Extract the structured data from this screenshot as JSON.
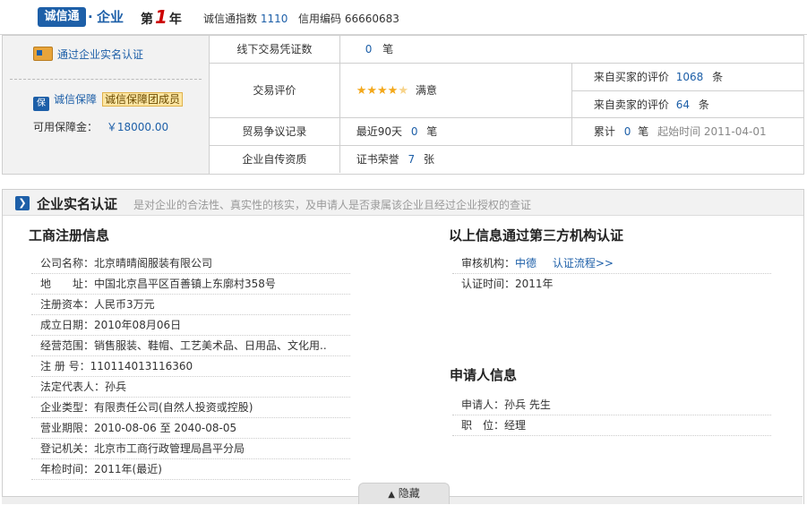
{
  "header": {
    "logo_text": "诚信通",
    "logo_dot": "·",
    "logo_ent": "企业",
    "year_prefix": "第",
    "year_num": "1",
    "year_suffix": "年",
    "index_label": "诚信通指数",
    "index_value": "1110",
    "code_label": "信用编码",
    "code_value": "66660683"
  },
  "left_panel": {
    "verify_link": "通过企业实名认证",
    "guarantee_icon": "保",
    "guarantee_label": "诚信保障",
    "guarantee_badge": "诚信保障团成员",
    "deposit_label": "可用保障金：",
    "deposit_value": "￥18000.00"
  },
  "grid": {
    "offline_label": "线下交易凭证数",
    "offline_value": "0",
    "offline_unit": "笔",
    "eval_label": "交易评价",
    "eval_rating": "满意",
    "eval_stars": 4.5,
    "buyer_label": "来自买家的评价",
    "buyer_value": "1068",
    "buyer_unit": "条",
    "seller_label": "来自卖家的评价",
    "seller_value": "64",
    "seller_unit": "条",
    "dispute_label": "贸易争议记录",
    "dispute_recent_label": "最近90天",
    "dispute_recent_value": "0",
    "dispute_recent_unit": "笔",
    "dispute_total_label": "累计",
    "dispute_total_value": "0",
    "dispute_total_unit": "笔",
    "dispute_start": "起始时间 2011-04-01",
    "self_label": "企业自传资质",
    "cert_label": "证书荣誉",
    "cert_value": "7",
    "cert_unit": "张"
  },
  "section": {
    "title": "企业实名认证",
    "desc": "是对企业的合法性、真实性的核实，及申请人是否隶属该企业且经过企业授权的查证"
  },
  "registration": {
    "title": "工商注册信息",
    "rows": [
      {
        "label": "公司名称：",
        "value": "北京晴晴阁服装有限公司"
      },
      {
        "label": "地　　址：",
        "value": "中国北京昌平区百善镇上东廓村358号"
      },
      {
        "label": "注册资本：",
        "value": "人民币3万元"
      },
      {
        "label": "成立日期：",
        "value": "2010年08月06日"
      },
      {
        "label": "经营范围：",
        "value": "销售服装、鞋帽、工艺美术品、日用品、文化用.."
      },
      {
        "label": "注 册 号：",
        "value": "110114013116360"
      },
      {
        "label": "法定代表人：",
        "value": "孙兵"
      },
      {
        "label": "企业类型：",
        "value": "有限责任公司(自然人投资或控股)"
      },
      {
        "label": "营业期限：",
        "value": "2010-08-06 至 2040-08-05"
      },
      {
        "label": "登记机关：",
        "value": "北京市工商行政管理局昌平分局"
      },
      {
        "label": "年检时间：",
        "value": "2011年(最近)"
      }
    ]
  },
  "third_party": {
    "title": "以上信息通过第三方机构认证",
    "auditor_label": "审核机构：",
    "auditor_value": "中德",
    "process_link": "认证流程>>",
    "time_label": "认证时间：",
    "time_value": "2011年"
  },
  "applicant": {
    "title": "申请人信息",
    "name_label": "申请人：",
    "name_value": "孙兵 先生",
    "position_label": "职　位：",
    "position_value": "经理"
  },
  "footer": {
    "hide_label": "隐藏"
  }
}
